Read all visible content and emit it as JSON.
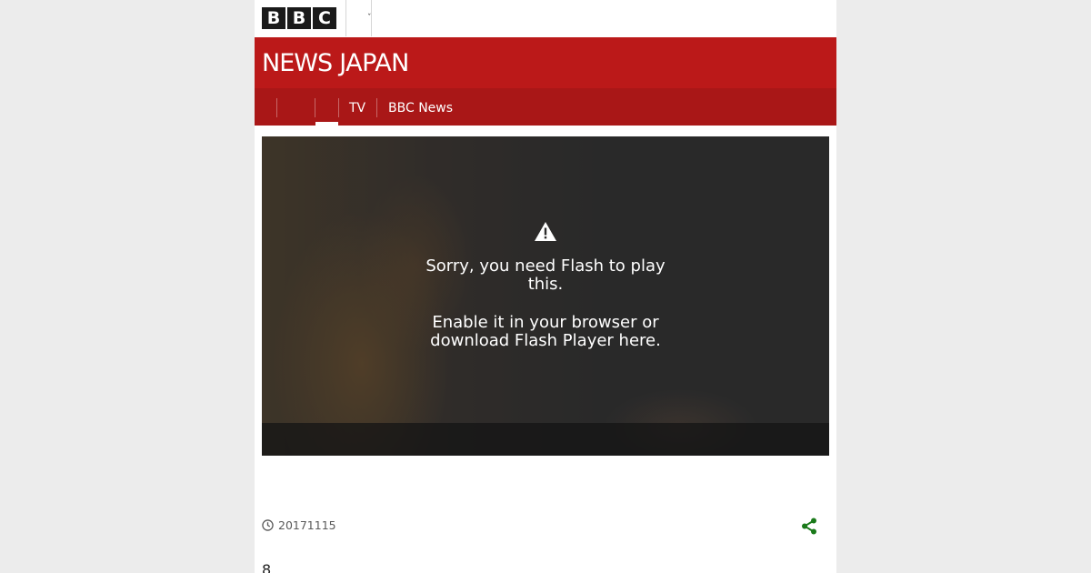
{
  "brand": {
    "logo_letters": [
      "B",
      "B",
      "C"
    ],
    "site_title_primary": "NEWS",
    "site_title_secondary": "JAPAN"
  },
  "nav": {
    "items": [
      {
        "label": "",
        "active": false
      },
      {
        "label": "",
        "active": false
      },
      {
        "label": "",
        "active": true
      },
      {
        "label": "TV",
        "active": false
      },
      {
        "label": "BBC News",
        "active": false
      }
    ]
  },
  "video": {
    "message_line1": "Sorry, you need Flash to play this.",
    "message_line2": "Enable it in your browser or download Flash Player here.",
    "icon": "warning-icon"
  },
  "article": {
    "date": "20171115",
    "body_start": "8"
  },
  "icons": {
    "clock": "clock-icon",
    "share": "share-icon"
  },
  "colors": {
    "header_red": "#bb1919",
    "nav_red": "#a91717",
    "share_green": "#1a7a1a"
  }
}
